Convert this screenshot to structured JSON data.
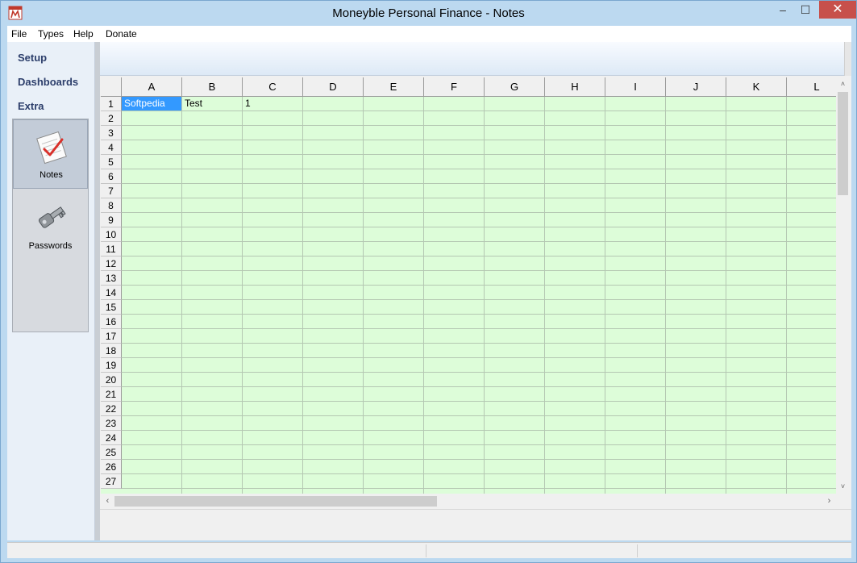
{
  "window": {
    "title": "Moneyble Personal Finance - Notes",
    "minimize_glyph": "–",
    "maximize_glyph": "☐",
    "close_glyph": "✕"
  },
  "menu": [
    "File",
    "Types",
    "Help",
    "Donate"
  ],
  "sidebar": {
    "sections": [
      "Setup",
      "Dashboards",
      "Extra"
    ],
    "buttons": [
      {
        "label": "Notes",
        "icon": "notes-icon",
        "active": true
      },
      {
        "label": "Passwords",
        "icon": "key-icon",
        "active": false
      }
    ]
  },
  "grid": {
    "columns": [
      "A",
      "B",
      "C",
      "D",
      "E",
      "F",
      "G",
      "H",
      "I",
      "J",
      "K",
      "L"
    ],
    "rows": [
      "1",
      "2",
      "3",
      "4",
      "5",
      "6",
      "7",
      "8",
      "9",
      "10",
      "11",
      "12",
      "13",
      "14",
      "15",
      "16",
      "17",
      "18",
      "19",
      "20",
      "21",
      "22",
      "23",
      "24",
      "25",
      "26",
      "27"
    ],
    "cells": [
      {
        "row": 1,
        "col": "A",
        "value": "Softpedia",
        "selected": true
      },
      {
        "row": 1,
        "col": "B",
        "value": "Test",
        "selected": false
      },
      {
        "row": 1,
        "col": "C",
        "value": "1",
        "selected": false
      }
    ],
    "cell_bg": "#ddfdd9",
    "selection_color": "#3399ff"
  },
  "scroll": {
    "up": "˄",
    "down": "˅",
    "left": "‹",
    "right": "›"
  }
}
